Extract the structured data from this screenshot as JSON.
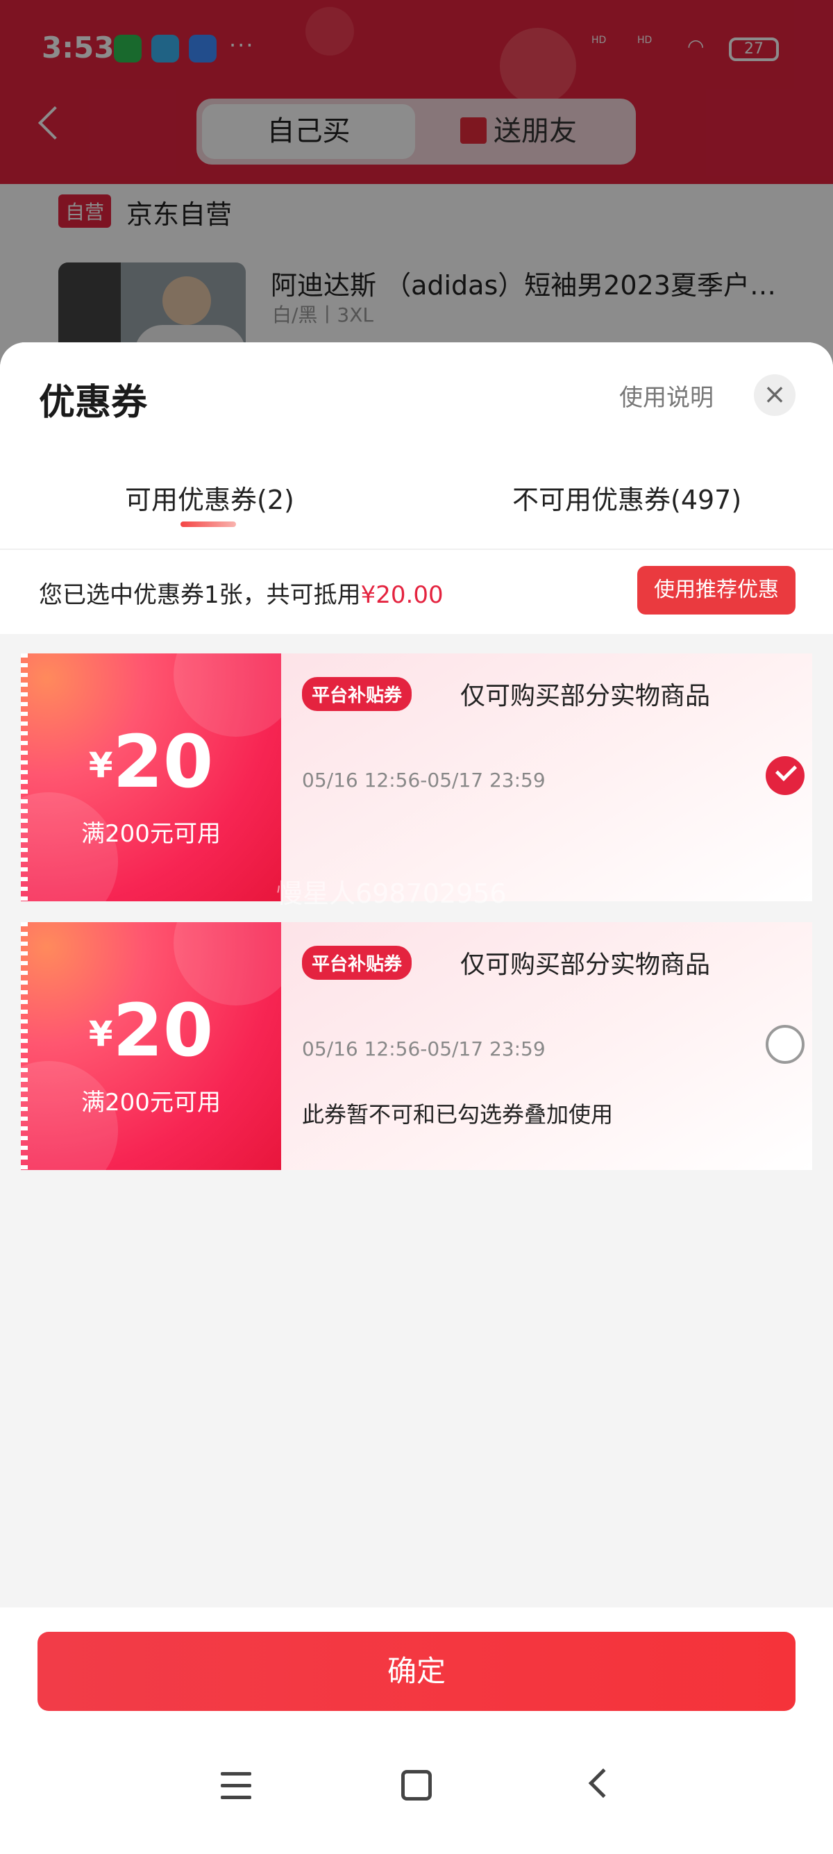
{
  "status_bar": {
    "time": "3:53",
    "more": "···",
    "signal_1": "HD",
    "signal_2": "HD",
    "battery": "27"
  },
  "header": {
    "seg_self": "自己买",
    "seg_gift": "送朋友"
  },
  "background": {
    "self_tag": "自营",
    "shop_name": "京东自营",
    "product_title": "阿迪达斯 （adidas）短袖男2023夏季户…",
    "product_spec": "白/黑丨3XL"
  },
  "sheet": {
    "title": "优惠券",
    "help": "使用说明",
    "close": "×",
    "tabs": {
      "available": "可用优惠券(2)",
      "unavailable": "不可用优惠券(497)"
    },
    "summary_prefix": "您已选中优惠券1张，共可抵用",
    "summary_amount": "¥20.00",
    "recommend_btn": "使用推荐优惠"
  },
  "coupons": [
    {
      "yen": "¥",
      "value": "20",
      "condition": "满200元可用",
      "badge": "平台补贴券",
      "desc": "仅可购买部分实物商品",
      "date": "05/16 12:56-05/17 23:59",
      "note": "",
      "selected": true
    },
    {
      "yen": "¥",
      "value": "20",
      "condition": "满200元可用",
      "badge": "平台补贴券",
      "desc": "仅可购买部分实物商品",
      "date": "05/16 12:56-05/17 23:59",
      "note": "此券暂不可和已勾选券叠加使用",
      "selected": false
    }
  ],
  "watermark": "慢星人698702956",
  "confirm": "确定"
}
